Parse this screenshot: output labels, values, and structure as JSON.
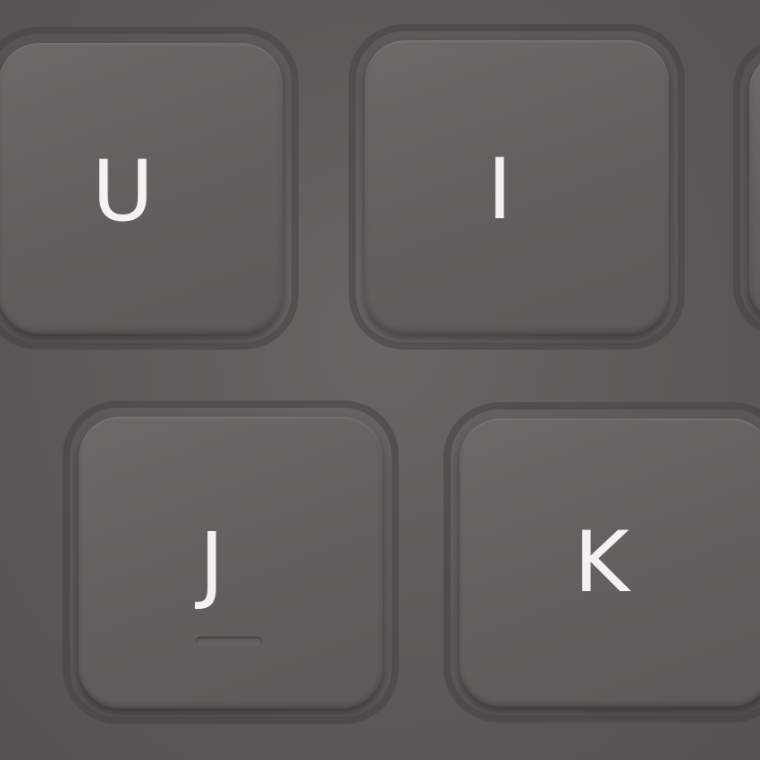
{
  "keys": [
    {
      "id": "u",
      "label": "U"
    },
    {
      "id": "i",
      "label": "I"
    },
    {
      "id": "j",
      "label": "J"
    },
    {
      "id": "k",
      "label": "K"
    }
  ],
  "colors": {
    "key_surface": "#66615e",
    "background": "#5f5a57",
    "legend": "#f4f2ef"
  }
}
